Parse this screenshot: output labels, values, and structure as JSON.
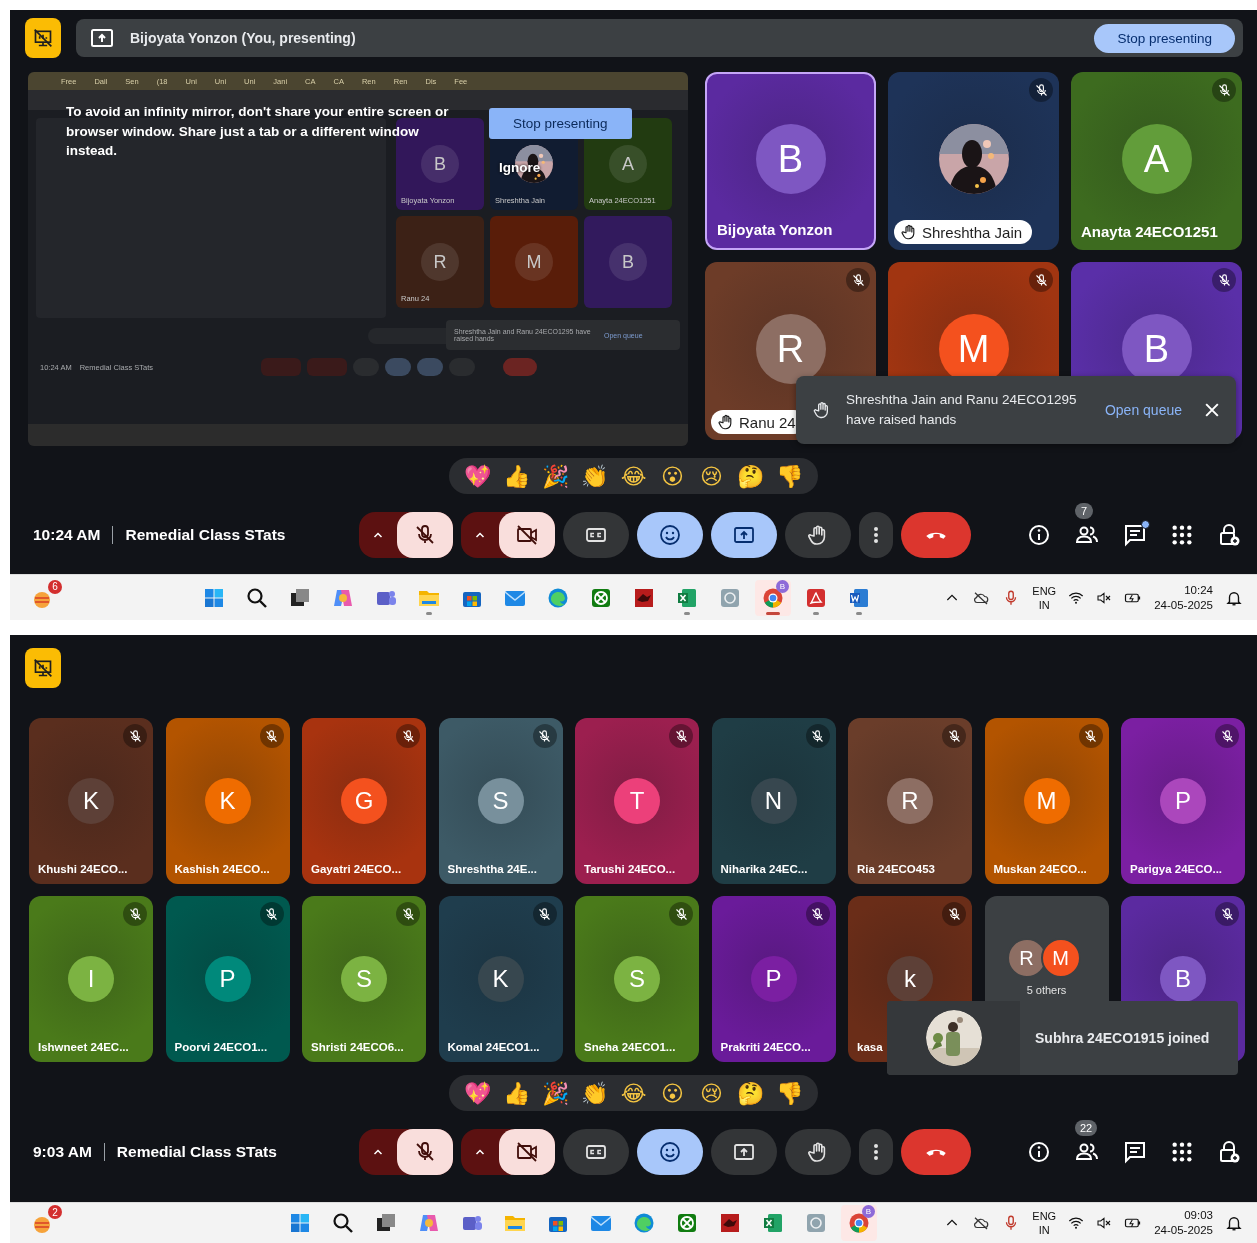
{
  "screens": [
    {
      "kind": "presenting",
      "banner": {
        "text": "Bijoyata Yonzon (You, presenting)",
        "button": "Stop presenting"
      },
      "mirror": {
        "tabs": [
          "Free",
          "Dail",
          "Sen",
          "(18",
          "Uni",
          "Uni",
          "Uni",
          "Jani",
          "CA",
          "CA",
          "Ren",
          "Ren",
          "Dis",
          "Fee"
        ],
        "warning": "To avoid an infinity mirror, don't share your entire screen or browser window. Share just a tab or a different window instead.",
        "button": "Stop presenting",
        "ignore": "Ignore",
        "tiles": [
          {
            "kind": "initial",
            "initial": "B",
            "name": "Bijoyata Yonzon",
            "color": "#32175a"
          },
          {
            "name": "Shreshtha Jain",
            "color": "#111c31"
          },
          {
            "kind": "initial",
            "initial": "A",
            "name": "Anayta 24ECO1251",
            "color": "#223b11"
          },
          {
            "kind": "initial",
            "initial": "R",
            "name": "Ranu 24",
            "color": "#3c2116"
          },
          {
            "kind": "initial",
            "initial": "M",
            "color": "#591d09"
          },
          {
            "kind": "initial",
            "initial": "B",
            "color": "#321a5d"
          }
        ],
        "toast": "Shreshtha Jain and Ranu 24ECO1295 have raised hands",
        "toast_link": "Open queue",
        "time": "10:24 AM",
        "meeting": "Remedial Class STats"
      },
      "tiles": [
        {
          "kind": "initial",
          "avatar": {
            "initial": "B",
            "color": "#7e57c2"
          },
          "name": "Bijoyata Yonzon",
          "color": "#5b2aa0",
          "muted": false,
          "hand_raised": false,
          "selected": true
        },
        {
          "name": "Shreshtha Jain",
          "color": "#1e3358",
          "muted": true,
          "hand_raised": true,
          "selected": false
        },
        {
          "kind": "initial",
          "avatar": {
            "initial": "A",
            "color": "#629d3a"
          },
          "name": "Anayta 24ECO1251",
          "color": "#3d6b1f",
          "muted": true,
          "hand_raised": false,
          "selected": false
        },
        {
          "kind": "initial",
          "avatar": {
            "initial": "R",
            "color": "#8d6e63"
          },
          "name": "Ranu 24",
          "color": "#6d3c28",
          "muted": true,
          "hand_raised": true,
          "selected": false
        },
        {
          "kind": "initial",
          "avatar": {
            "initial": "M",
            "color": "#f4511e"
          },
          "color": "#a13511",
          "muted": true,
          "hand_raised": false,
          "selected": false
        },
        {
          "kind": "initial",
          "avatar": {
            "initial": "B",
            "color": "#7e57c2"
          },
          "color": "#5a2fa8",
          "muted": true,
          "hand_raised": false,
          "selected": false
        }
      ],
      "toast": {
        "kind": "hands",
        "text": "Shreshtha Jain and Ranu 24ECO1295 have raised hands",
        "link": "Open queue"
      },
      "reactions": [
        "💖",
        "👍",
        "🎉",
        "👏",
        "😂",
        "😮",
        "😢",
        "🤔",
        "👎"
      ],
      "time": "10:24 AM",
      "meeting": "Remedial Class STats",
      "controls": [
        {
          "kind": "mic",
          "on": false
        },
        {
          "kind": "camera",
          "on": false
        },
        {
          "kind": "captions",
          "selected": false
        },
        {
          "kind": "reactions",
          "selected": true
        },
        {
          "kind": "present",
          "selected": true
        },
        {
          "kind": "hand",
          "selected": false
        },
        {
          "kind": "more"
        },
        {
          "kind": "leave"
        }
      ],
      "people_count": "7",
      "chat_unread": true,
      "taskbar": {
        "widget_badge": "6",
        "apps": [
          {
            "kind": "start",
            "running": false
          },
          {
            "kind": "search",
            "running": false
          },
          {
            "kind": "taskview",
            "running": false
          },
          {
            "kind": "copilot",
            "running": false
          },
          {
            "kind": "teams",
            "running": false
          },
          {
            "kind": "files",
            "running": true
          },
          {
            "kind": "store",
            "running": false
          },
          {
            "kind": "mail",
            "running": false
          },
          {
            "kind": "edge",
            "running": false
          },
          {
            "kind": "xbox",
            "running": false
          },
          {
            "kind": "game",
            "running": false
          },
          {
            "kind": "excel",
            "running": true
          },
          {
            "kind": "remote",
            "running": false
          },
          {
            "kind": "chrome",
            "running": true,
            "selected": true,
            "badge": "B"
          },
          {
            "kind": "acrobat",
            "running": true
          },
          {
            "kind": "word",
            "running": true
          }
        ],
        "lang": "ENG",
        "region": "IN",
        "clock": "10:24",
        "date": "24-05-2025"
      }
    },
    {
      "kind": "grid",
      "tiles": [
        {
          "kind": "initial",
          "avatar": {
            "initial": "K",
            "color": "#5d4037"
          },
          "name": "Khushi 24ECO...",
          "color": "#5a2e1e",
          "muted": true
        },
        {
          "kind": "initial",
          "avatar": {
            "initial": "K",
            "color": "#ef6c00"
          },
          "name": "Kashish 24ECO...",
          "color": "#b35400",
          "muted": true
        },
        {
          "kind": "initial",
          "avatar": {
            "initial": "G",
            "color": "#f4511e"
          },
          "name": "Gayatri 24ECO...",
          "color": "#a8330f",
          "muted": true
        },
        {
          "kind": "initial",
          "avatar": {
            "initial": "S",
            "color": "#78909c"
          },
          "name": "Shreshtha 24E...",
          "color": "#3d5a66",
          "muted": true
        },
        {
          "kind": "initial",
          "avatar": {
            "initial": "T",
            "color": "#ec407a"
          },
          "name": "Tarushi 24ECO...",
          "color": "#9c1f4f",
          "muted": true
        },
        {
          "kind": "initial",
          "avatar": {
            "initial": "N",
            "color": "#37474f"
          },
          "name": "Niharika 24EC...",
          "color": "#1f3d45",
          "muted": true
        },
        {
          "kind": "initial",
          "avatar": {
            "initial": "R",
            "color": "#8d6e63"
          },
          "name": "Ria 24ECO453",
          "color": "#6a3d2a",
          "muted": true
        },
        {
          "kind": "initial",
          "avatar": {
            "initial": "M",
            "color": "#ef6c00"
          },
          "name": "Muskan 24ECO...",
          "color": "#b35400",
          "muted": true
        },
        {
          "kind": "initial",
          "avatar": {
            "initial": "P",
            "color": "#ab47bc"
          },
          "name": "Parigya 24ECO...",
          "color": "#7b1fa2",
          "muted": true
        },
        {
          "kind": "initial",
          "avatar": {
            "initial": "I",
            "color": "#7cb342"
          },
          "name": "Ishwneet 24EC...",
          "color": "#4a7a1a",
          "muted": true
        },
        {
          "kind": "initial",
          "avatar": {
            "initial": "P",
            "color": "#00897b"
          },
          "name": "Poorvi 24ECO1...",
          "color": "#00594f",
          "muted": true
        },
        {
          "kind": "initial",
          "avatar": {
            "initial": "S",
            "color": "#7cb342"
          },
          "name": "Shristi 24ECO6...",
          "color": "#4a7a1a",
          "muted": true
        },
        {
          "kind": "initial",
          "avatar": {
            "initial": "K",
            "color": "#37474f"
          },
          "name": "Komal 24ECO1...",
          "color": "#1f3d4d",
          "muted": true
        },
        {
          "kind": "initial",
          "avatar": {
            "initial": "S",
            "color": "#7cb342"
          },
          "name": "Sneha 24ECO1...",
          "color": "#4a7a1a",
          "muted": true
        },
        {
          "kind": "initial",
          "avatar": {
            "initial": "P",
            "color": "#7b1fa2"
          },
          "name": "Prakriti 24ECO...",
          "color": "#6a1b9a",
          "muted": true
        },
        {
          "kind": "initial",
          "avatar": {
            "initial": "k",
            "color": "#5d4037"
          },
          "name": "kasa",
          "color": "#6a2d18",
          "muted": true
        },
        {
          "kind": "others",
          "label": "5 others",
          "color": "#3c4043",
          "avatars": [
            {
              "initial": "R",
              "color": "#8d6e63"
            },
            {
              "initial": "M",
              "color": "#f4511e"
            }
          ]
        },
        {
          "kind": "initial",
          "avatar": {
            "initial": "B",
            "color": "#7e57c2"
          },
          "color": "#5b2aa0",
          "muted": true
        }
      ],
      "toast": {
        "kind": "joined",
        "text": "Subhra 24ECO1915 joined"
      },
      "reactions": [
        "💖",
        "👍",
        "🎉",
        "👏",
        "😂",
        "😮",
        "😢",
        "🤔",
        "👎"
      ],
      "time": "9:03 AM",
      "meeting": "Remedial Class STats",
      "controls": [
        {
          "kind": "mic",
          "on": false
        },
        {
          "kind": "camera",
          "on": false
        },
        {
          "kind": "captions",
          "selected": false
        },
        {
          "kind": "reactions",
          "selected": true
        },
        {
          "kind": "present",
          "selected": false
        },
        {
          "kind": "hand",
          "selected": false
        },
        {
          "kind": "more"
        },
        {
          "kind": "leave"
        }
      ],
      "people_count": "22",
      "chat_unread": false,
      "taskbar": {
        "widget_badge": "2",
        "apps": [
          {
            "kind": "start",
            "running": false
          },
          {
            "kind": "search",
            "running": false
          },
          {
            "kind": "taskview",
            "running": false
          },
          {
            "kind": "copilot",
            "running": false
          },
          {
            "kind": "teams",
            "running": false
          },
          {
            "kind": "files",
            "running": false
          },
          {
            "kind": "store",
            "running": false
          },
          {
            "kind": "mail",
            "running": false
          },
          {
            "kind": "edge",
            "running": false
          },
          {
            "kind": "xbox",
            "running": false
          },
          {
            "kind": "game",
            "running": false
          },
          {
            "kind": "excel",
            "running": false
          },
          {
            "kind": "remote",
            "running": false
          },
          {
            "kind": "chrome",
            "running": false,
            "selected": true,
            "badge": "B"
          }
        ],
        "lang": "ENG",
        "region": "IN",
        "clock": "09:03",
        "date": "24-05-2025"
      }
    }
  ]
}
